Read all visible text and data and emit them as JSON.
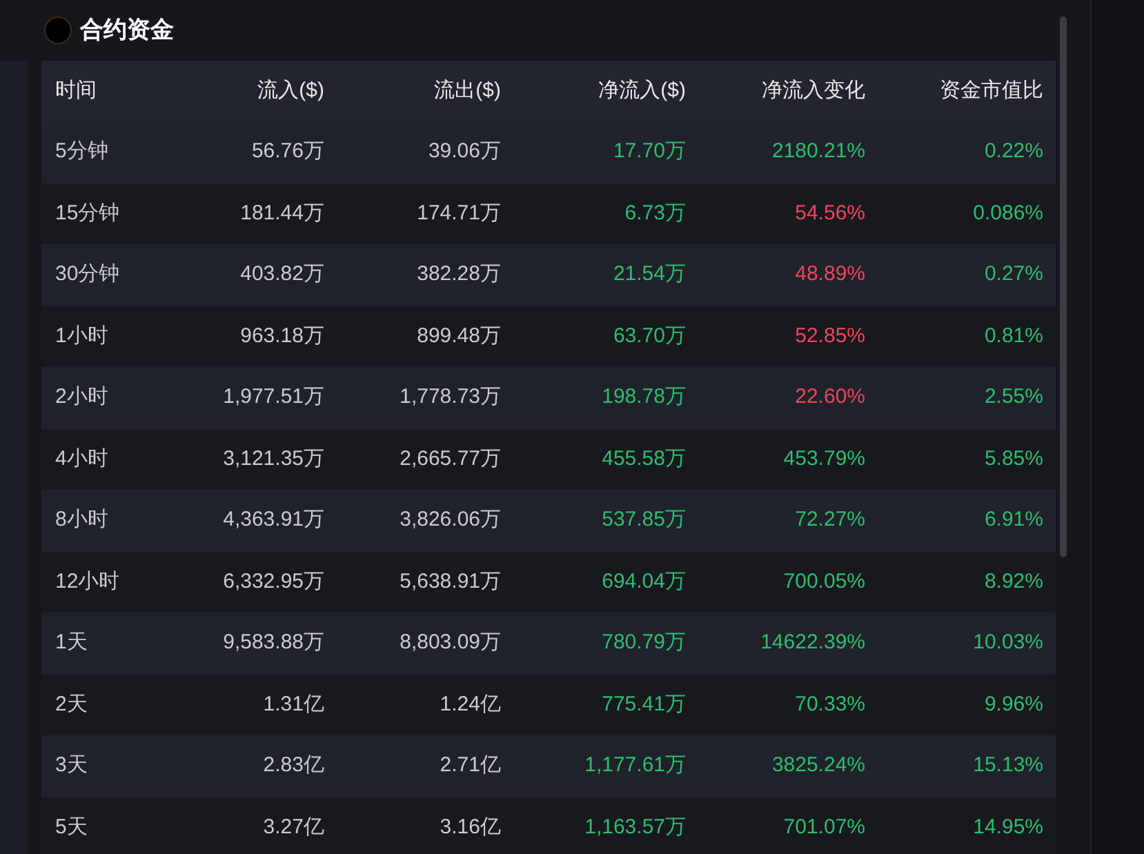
{
  "title": "合约资金",
  "table": {
    "columns": [
      "时间",
      "流入($)",
      "流出($)",
      "净流入($)",
      "净流入变化",
      "资金市值比"
    ],
    "rows": [
      {
        "time": "5分钟",
        "inflow": "56.76万",
        "outflow": "39.06万",
        "net_inflow": "17.70万",
        "net_change": "2180.21%",
        "negative": false,
        "cap_ratio": "0.22%"
      },
      {
        "time": "15分钟",
        "inflow": "181.44万",
        "outflow": "174.71万",
        "net_inflow": "6.73万",
        "net_change": "54.56%",
        "negative": true,
        "cap_ratio": "0.086%"
      },
      {
        "time": "30分钟",
        "inflow": "403.82万",
        "outflow": "382.28万",
        "net_inflow": "21.54万",
        "net_change": "48.89%",
        "negative": true,
        "cap_ratio": "0.27%"
      },
      {
        "time": "1小时",
        "inflow": "963.18万",
        "outflow": "899.48万",
        "net_inflow": "63.70万",
        "net_change": "52.85%",
        "negative": true,
        "cap_ratio": "0.81%"
      },
      {
        "time": "2小时",
        "inflow": "1,977.51万",
        "outflow": "1,778.73万",
        "net_inflow": "198.78万",
        "net_change": "22.60%",
        "negative": true,
        "cap_ratio": "2.55%"
      },
      {
        "time": "4小时",
        "inflow": "3,121.35万",
        "outflow": "2,665.77万",
        "net_inflow": "455.58万",
        "net_change": "453.79%",
        "negative": false,
        "cap_ratio": "5.85%"
      },
      {
        "time": "8小时",
        "inflow": "4,363.91万",
        "outflow": "3,826.06万",
        "net_inflow": "537.85万",
        "net_change": "72.27%",
        "negative": false,
        "cap_ratio": "6.91%"
      },
      {
        "time": "12小时",
        "inflow": "6,332.95万",
        "outflow": "5,638.91万",
        "net_inflow": "694.04万",
        "net_change": "700.05%",
        "negative": false,
        "cap_ratio": "8.92%"
      },
      {
        "time": "1天",
        "inflow": "9,583.88万",
        "outflow": "8,803.09万",
        "net_inflow": "780.79万",
        "net_change": "14622.39%",
        "negative": false,
        "cap_ratio": "10.03%"
      },
      {
        "time": "2天",
        "inflow": "1.31亿",
        "outflow": "1.24亿",
        "net_inflow": "775.41万",
        "net_change": "70.33%",
        "negative": false,
        "cap_ratio": "9.96%"
      },
      {
        "time": "3天",
        "inflow": "2.83亿",
        "outflow": "2.71亿",
        "net_inflow": "1,177.61万",
        "net_change": "3825.24%",
        "negative": false,
        "cap_ratio": "15.13%"
      },
      {
        "time": "5天",
        "inflow": "3.27亿",
        "outflow": "3.16亿",
        "net_inflow": "1,163.57万",
        "net_change": "701.07%",
        "negative": false,
        "cap_ratio": "14.95%"
      }
    ]
  }
}
